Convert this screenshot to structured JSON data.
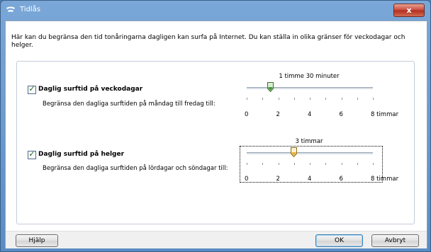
{
  "window": {
    "title": "Tidlås",
    "close_symbol": "x",
    "icon": "shield-icon"
  },
  "intro_text": "Här kan du begränsa den tid tonåringarna dagligen kan surfa på Internet. Du kan ställa in olika gränser för veckodagar och helger.",
  "weekdays": {
    "checked": true,
    "label": "Daglig surftid på veckodagar",
    "description": "Begränsa den dagliga surftiden på måndag till fredag till:",
    "value_label": "1 timme 30 minuter",
    "value_hours": 1.5
  },
  "weekend": {
    "checked": true,
    "label": "Daglig surftid på helger",
    "description": "Begränsa den dagliga surftiden på lördagar och söndagar till:",
    "value_label": "3 timmar",
    "value_hours": 3
  },
  "scale": {
    "max_hours": 8,
    "labels": [
      "0",
      "2",
      "4",
      "6",
      "8 timmar"
    ]
  },
  "buttons": {
    "help": "Hjälp",
    "ok": "OK",
    "cancel": "Avbryt"
  },
  "colors": {
    "titlebar": "#5a8cc4",
    "close_button": "#c9483a",
    "thumb_weekdays": "#4c9a3f",
    "thumb_weekend": "#e8b23a"
  }
}
